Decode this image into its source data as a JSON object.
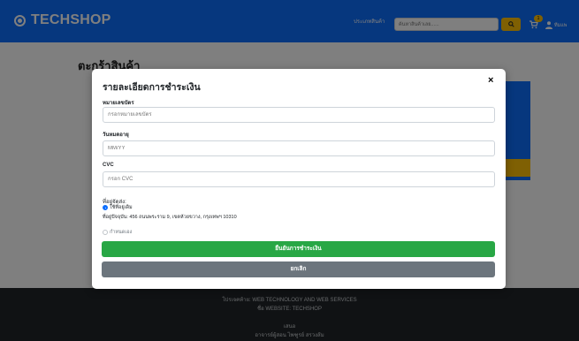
{
  "navbar": {
    "brand": "TECHSHOP",
    "category_link": "ประเภทสินค้า",
    "search_placeholder": "ค้นหาสินค้าเลย......",
    "cart_count": "1",
    "user_label": "ทีมแพ",
    "colors": {
      "bar": "#0d6efd",
      "search_button": "#ffc107"
    }
  },
  "page": {
    "title": "ตะกร้าสินค้า"
  },
  "footer": {
    "line1": "โปรเจคท้าย: WEB TECHNOLOGY AND WEB SERVICES",
    "line2": "ชื่อ WEBSITE: TECHSHOP",
    "line3": "เสนอ",
    "line4": "อาจารย์ผู้สอน ไพฑูรย์ สรวงส้ม"
  },
  "modal": {
    "title": "รายละเอียดการชำระเงิน",
    "close_symbol": "×",
    "card_number": {
      "label": "หมายเลขบัตร",
      "placeholder": "กรอกหมายเลขบัตร"
    },
    "expiry": {
      "label": "วันหมดอายุ",
      "placeholder": "MM/YY"
    },
    "cvc": {
      "label": "CVC",
      "placeholder": "กรอก CVC"
    },
    "address_label": "ที่อยู่จัดส่ง:",
    "address_options": [
      {
        "label": "ใช้ที่อยู่เดิม",
        "selected": true
      },
      {
        "label": "กำหนดเอง",
        "selected": false
      }
    ],
    "current_address": "ที่อยู่ปัจจุบัน: 456 ถนนพระราม 9, เขตห้วยขวาง, กรุงเทพฯ 10310",
    "confirm_button": "ยืนยันการชำระเงิน",
    "cancel_button": "ยกเลิก",
    "colors": {
      "confirm": "#28a745",
      "cancel": "#6c757d",
      "radio_selected": "#0d6efd"
    }
  }
}
